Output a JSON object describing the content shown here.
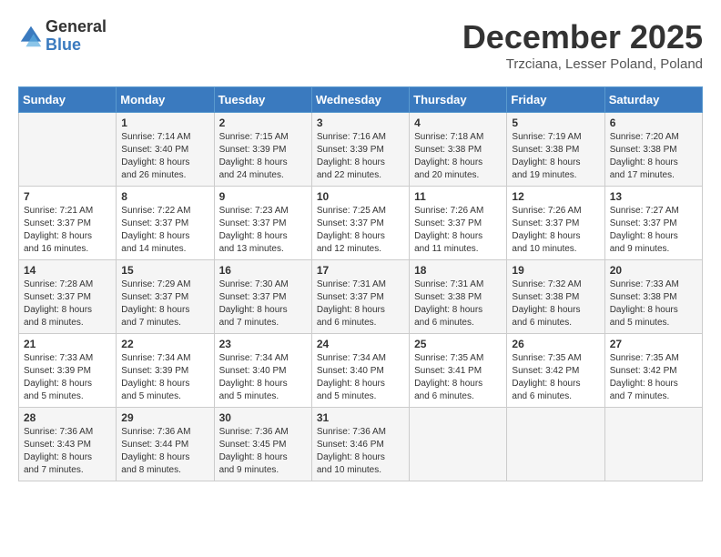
{
  "logo": {
    "general": "General",
    "blue": "Blue"
  },
  "title": "December 2025",
  "location": "Trzciana, Lesser Poland, Poland",
  "headers": [
    "Sunday",
    "Monday",
    "Tuesday",
    "Wednesday",
    "Thursday",
    "Friday",
    "Saturday"
  ],
  "weeks": [
    [
      {
        "day": "",
        "info": ""
      },
      {
        "day": "1",
        "info": "Sunrise: 7:14 AM\nSunset: 3:40 PM\nDaylight: 8 hours\nand 26 minutes."
      },
      {
        "day": "2",
        "info": "Sunrise: 7:15 AM\nSunset: 3:39 PM\nDaylight: 8 hours\nand 24 minutes."
      },
      {
        "day": "3",
        "info": "Sunrise: 7:16 AM\nSunset: 3:39 PM\nDaylight: 8 hours\nand 22 minutes."
      },
      {
        "day": "4",
        "info": "Sunrise: 7:18 AM\nSunset: 3:38 PM\nDaylight: 8 hours\nand 20 minutes."
      },
      {
        "day": "5",
        "info": "Sunrise: 7:19 AM\nSunset: 3:38 PM\nDaylight: 8 hours\nand 19 minutes."
      },
      {
        "day": "6",
        "info": "Sunrise: 7:20 AM\nSunset: 3:38 PM\nDaylight: 8 hours\nand 17 minutes."
      }
    ],
    [
      {
        "day": "7",
        "info": "Sunrise: 7:21 AM\nSunset: 3:37 PM\nDaylight: 8 hours\nand 16 minutes."
      },
      {
        "day": "8",
        "info": "Sunrise: 7:22 AM\nSunset: 3:37 PM\nDaylight: 8 hours\nand 14 minutes."
      },
      {
        "day": "9",
        "info": "Sunrise: 7:23 AM\nSunset: 3:37 PM\nDaylight: 8 hours\nand 13 minutes."
      },
      {
        "day": "10",
        "info": "Sunrise: 7:25 AM\nSunset: 3:37 PM\nDaylight: 8 hours\nand 12 minutes."
      },
      {
        "day": "11",
        "info": "Sunrise: 7:26 AM\nSunset: 3:37 PM\nDaylight: 8 hours\nand 11 minutes."
      },
      {
        "day": "12",
        "info": "Sunrise: 7:26 AM\nSunset: 3:37 PM\nDaylight: 8 hours\nand 10 minutes."
      },
      {
        "day": "13",
        "info": "Sunrise: 7:27 AM\nSunset: 3:37 PM\nDaylight: 8 hours\nand 9 minutes."
      }
    ],
    [
      {
        "day": "14",
        "info": "Sunrise: 7:28 AM\nSunset: 3:37 PM\nDaylight: 8 hours\nand 8 minutes."
      },
      {
        "day": "15",
        "info": "Sunrise: 7:29 AM\nSunset: 3:37 PM\nDaylight: 8 hours\nand 7 minutes."
      },
      {
        "day": "16",
        "info": "Sunrise: 7:30 AM\nSunset: 3:37 PM\nDaylight: 8 hours\nand 7 minutes."
      },
      {
        "day": "17",
        "info": "Sunrise: 7:31 AM\nSunset: 3:37 PM\nDaylight: 8 hours\nand 6 minutes."
      },
      {
        "day": "18",
        "info": "Sunrise: 7:31 AM\nSunset: 3:38 PM\nDaylight: 8 hours\nand 6 minutes."
      },
      {
        "day": "19",
        "info": "Sunrise: 7:32 AM\nSunset: 3:38 PM\nDaylight: 8 hours\nand 6 minutes."
      },
      {
        "day": "20",
        "info": "Sunrise: 7:33 AM\nSunset: 3:38 PM\nDaylight: 8 hours\nand 5 minutes."
      }
    ],
    [
      {
        "day": "21",
        "info": "Sunrise: 7:33 AM\nSunset: 3:39 PM\nDaylight: 8 hours\nand 5 minutes."
      },
      {
        "day": "22",
        "info": "Sunrise: 7:34 AM\nSunset: 3:39 PM\nDaylight: 8 hours\nand 5 minutes."
      },
      {
        "day": "23",
        "info": "Sunrise: 7:34 AM\nSunset: 3:40 PM\nDaylight: 8 hours\nand 5 minutes."
      },
      {
        "day": "24",
        "info": "Sunrise: 7:34 AM\nSunset: 3:40 PM\nDaylight: 8 hours\nand 5 minutes."
      },
      {
        "day": "25",
        "info": "Sunrise: 7:35 AM\nSunset: 3:41 PM\nDaylight: 8 hours\nand 6 minutes."
      },
      {
        "day": "26",
        "info": "Sunrise: 7:35 AM\nSunset: 3:42 PM\nDaylight: 8 hours\nand 6 minutes."
      },
      {
        "day": "27",
        "info": "Sunrise: 7:35 AM\nSunset: 3:42 PM\nDaylight: 8 hours\nand 7 minutes."
      }
    ],
    [
      {
        "day": "28",
        "info": "Sunrise: 7:36 AM\nSunset: 3:43 PM\nDaylight: 8 hours\nand 7 minutes."
      },
      {
        "day": "29",
        "info": "Sunrise: 7:36 AM\nSunset: 3:44 PM\nDaylight: 8 hours\nand 8 minutes."
      },
      {
        "day": "30",
        "info": "Sunrise: 7:36 AM\nSunset: 3:45 PM\nDaylight: 8 hours\nand 9 minutes."
      },
      {
        "day": "31",
        "info": "Sunrise: 7:36 AM\nSunset: 3:46 PM\nDaylight: 8 hours\nand 10 minutes."
      },
      {
        "day": "",
        "info": ""
      },
      {
        "day": "",
        "info": ""
      },
      {
        "day": "",
        "info": ""
      }
    ]
  ]
}
